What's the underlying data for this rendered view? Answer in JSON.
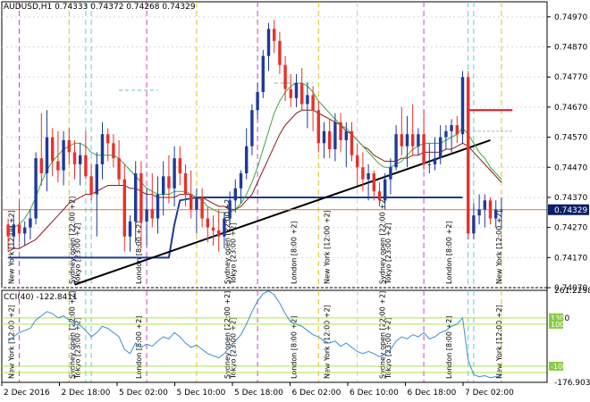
{
  "header": {
    "symbol": "AUDUSD,H1",
    "ohlc": "0.74333 0.74372 0.74268 0.74329"
  },
  "cci_label": "CCI(40) -122.8411",
  "price_tag": "0.74329",
  "colors": {
    "up": "#1e3a9a",
    "down": "#e8312a",
    "ma_fast": "#3aaa3a",
    "ma_slow": "#8b1a1a",
    "channel": "#1e3a9a",
    "trend": "#000000",
    "cci_line": "#3d8fd0",
    "cci_level": "#aee34a",
    "session_magenta": "#cc44cc",
    "session_yellow": "#e0c020",
    "session_cyan": "#66cccc",
    "session_gray": "#c8c8c8"
  },
  "chart_data": [
    {
      "type": "candlestick",
      "title": "AUDUSD,H1",
      "ylim": [
        0.7407,
        0.7502
      ],
      "y_ticks": [
        "0.74970",
        "0.74870",
        "0.74770",
        "0.74670",
        "0.74570",
        "0.74470",
        "0.74370",
        "0.74270",
        "0.74170",
        "0.74070"
      ],
      "x_ticks": [
        "2 Dec 2016",
        "2 Dec 18:00",
        "5 Dec 02:00",
        "5 Dec 10:00",
        "5 Dec 18:00",
        "6 Dec 02:00",
        "6 Dec 10:00",
        "6 Dec 18:00",
        "7 Dec 02:00"
      ],
      "candles": [
        [
          0.7428,
          0.743,
          0.7419,
          0.7424
        ],
        [
          0.7424,
          0.7431,
          0.742,
          0.7428
        ],
        [
          0.7428,
          0.7435,
          0.7422,
          0.7425
        ],
        [
          0.7425,
          0.7429,
          0.7421,
          0.7427
        ],
        [
          0.7427,
          0.7433,
          0.7423,
          0.743
        ],
        [
          0.743,
          0.7452,
          0.7428,
          0.745
        ],
        [
          0.745,
          0.7465,
          0.7441,
          0.7445
        ],
        [
          0.7445,
          0.7466,
          0.7439,
          0.7457
        ],
        [
          0.7457,
          0.746,
          0.7444,
          0.7449
        ],
        [
          0.7449,
          0.7459,
          0.7442,
          0.7446
        ],
        [
          0.7446,
          0.7459,
          0.7441,
          0.7456
        ],
        [
          0.7456,
          0.746,
          0.7448,
          0.7452
        ],
        [
          0.7452,
          0.7456,
          0.7443,
          0.7448
        ],
        [
          0.7448,
          0.7455,
          0.7441,
          0.7451
        ],
        [
          0.7451,
          0.7459,
          0.7443,
          0.7444
        ],
        [
          0.7444,
          0.7448,
          0.7436,
          0.7438
        ],
        [
          0.7438,
          0.7452,
          0.7424,
          0.7448
        ],
        [
          0.7448,
          0.7462,
          0.7443,
          0.7458
        ],
        [
          0.7458,
          0.746,
          0.7449,
          0.7455
        ],
        [
          0.7455,
          0.7458,
          0.7447,
          0.745
        ],
        [
          0.745,
          0.7456,
          0.7441,
          0.7443
        ],
        [
          0.7443,
          0.7448,
          0.7419,
          0.7424
        ],
        [
          0.7424,
          0.7431,
          0.7419,
          0.7429
        ],
        [
          0.7429,
          0.7449,
          0.7422,
          0.7445
        ],
        [
          0.7445,
          0.7449,
          0.742,
          0.7429
        ],
        [
          0.7429,
          0.744,
          0.7421,
          0.7433
        ],
        [
          0.7433,
          0.7445,
          0.7427,
          0.743
        ],
        [
          0.743,
          0.7444,
          0.7425,
          0.7438
        ],
        [
          0.7438,
          0.7449,
          0.7431,
          0.7444
        ],
        [
          0.7444,
          0.7451,
          0.7435,
          0.744
        ],
        [
          0.744,
          0.7454,
          0.7434,
          0.745
        ],
        [
          0.745,
          0.7454,
          0.7441,
          0.7445
        ],
        [
          0.7445,
          0.7448,
          0.7434,
          0.7438
        ],
        [
          0.7438,
          0.7446,
          0.743,
          0.7433
        ],
        [
          0.7433,
          0.744,
          0.7425,
          0.7437
        ],
        [
          0.7437,
          0.744,
          0.7427,
          0.743
        ],
        [
          0.743,
          0.7434,
          0.7422,
          0.7427
        ],
        [
          0.7427,
          0.7431,
          0.7421,
          0.7426
        ],
        [
          0.7426,
          0.7433,
          0.7419,
          0.7424
        ],
        [
          0.7424,
          0.7432,
          0.742,
          0.743
        ],
        [
          0.743,
          0.7439,
          0.7428,
          0.7436
        ],
        [
          0.7436,
          0.7443,
          0.7432,
          0.744
        ],
        [
          0.744,
          0.7446,
          0.7435,
          0.7445
        ],
        [
          0.7445,
          0.746,
          0.7443,
          0.7454
        ],
        [
          0.7454,
          0.7468,
          0.7451,
          0.7466
        ],
        [
          0.7466,
          0.7475,
          0.7463,
          0.7472
        ],
        [
          0.7472,
          0.7486,
          0.747,
          0.7484
        ],
        [
          0.7484,
          0.7495,
          0.7479,
          0.7493
        ],
        [
          0.7493,
          0.7496,
          0.7485,
          0.7489
        ],
        [
          0.7489,
          0.7492,
          0.7478,
          0.7481
        ],
        [
          0.7481,
          0.7484,
          0.7469,
          0.7473
        ],
        [
          0.7473,
          0.7478,
          0.7467,
          0.747
        ],
        [
          0.747,
          0.7478,
          0.7467,
          0.7475
        ],
        [
          0.7475,
          0.748,
          0.7466,
          0.7468
        ],
        [
          0.7468,
          0.7475,
          0.746,
          0.7471
        ],
        [
          0.7471,
          0.7474,
          0.7459,
          0.7466
        ],
        [
          0.7466,
          0.7469,
          0.7452,
          0.7455
        ],
        [
          0.7455,
          0.7462,
          0.745,
          0.7459
        ],
        [
          0.7459,
          0.7463,
          0.745,
          0.7453
        ],
        [
          0.7453,
          0.7465,
          0.7449,
          0.7462
        ],
        [
          0.7462,
          0.7465,
          0.7452,
          0.7456
        ],
        [
          0.7456,
          0.7462,
          0.7447,
          0.7459
        ],
        [
          0.7459,
          0.7462,
          0.7449,
          0.7451
        ],
        [
          0.7451,
          0.7455,
          0.7441,
          0.7447
        ],
        [
          0.7447,
          0.7452,
          0.7439,
          0.7443
        ],
        [
          0.7443,
          0.7448,
          0.7436,
          0.7445
        ],
        [
          0.7445,
          0.7446,
          0.7436,
          0.7439
        ],
        [
          0.7439,
          0.7442,
          0.7434,
          0.7436
        ],
        [
          0.7436,
          0.7445,
          0.7433,
          0.7443
        ],
        [
          0.7443,
          0.745,
          0.7438,
          0.7447
        ],
        [
          0.7447,
          0.7461,
          0.7446,
          0.7458
        ],
        [
          0.7458,
          0.7467,
          0.7451,
          0.7454
        ],
        [
          0.7454,
          0.7464,
          0.7447,
          0.7458
        ],
        [
          0.7458,
          0.7468,
          0.7451,
          0.7454
        ],
        [
          0.7454,
          0.746,
          0.7451,
          0.7458
        ],
        [
          0.7458,
          0.7466,
          0.7446,
          0.7448
        ],
        [
          0.7448,
          0.7455,
          0.7445,
          0.7448
        ],
        [
          0.7448,
          0.7457,
          0.7446,
          0.745
        ],
        [
          0.745,
          0.7461,
          0.7448,
          0.7457
        ],
        [
          0.7457,
          0.7461,
          0.7453,
          0.7459
        ],
        [
          0.7459,
          0.7463,
          0.7452,
          0.7461
        ],
        [
          0.7461,
          0.7464,
          0.7455,
          0.7458
        ],
        [
          0.7458,
          0.7479,
          0.7455,
          0.7477
        ],
        [
          0.7477,
          0.7479,
          0.7423,
          0.7425
        ],
        [
          0.7425,
          0.7435,
          0.7423,
          0.7431
        ],
        [
          0.7431,
          0.7438,
          0.7428,
          0.7433
        ],
        [
          0.7433,
          0.7438,
          0.7427,
          0.7436
        ],
        [
          0.7436,
          0.7437,
          0.7428,
          0.743
        ],
        [
          0.743,
          0.7436,
          0.7427,
          0.7433
        ],
        [
          0.7433,
          0.7437,
          0.7427,
          0.7433
        ]
      ],
      "ma_fast": [
        0.7427,
        0.7427,
        0.7428,
        0.743,
        0.7433,
        0.7437,
        0.7442,
        0.7446,
        0.7449,
        0.7451,
        0.7453,
        0.7454,
        0.7455,
        0.7455,
        0.7454,
        0.7452,
        0.7451,
        0.7451,
        0.7451,
        0.7451,
        0.745,
        0.7448,
        0.7446,
        0.7444,
        0.7442,
        0.744,
        0.7439,
        0.7438,
        0.7438,
        0.7438,
        0.7439,
        0.7439,
        0.7439,
        0.7438,
        0.7437,
        0.7436,
        0.7434,
        0.7433,
        0.7432,
        0.7432,
        0.7432,
        0.7433,
        0.7435,
        0.7438,
        0.7442,
        0.7447,
        0.7453,
        0.7459,
        0.7465,
        0.7469,
        0.7472,
        0.7474,
        0.7475,
        0.7475,
        0.7474,
        0.7472,
        0.7469,
        0.7467,
        0.7465,
        0.7463,
        0.7461,
        0.746,
        0.7458,
        0.7456,
        0.7454,
        0.7452,
        0.745,
        0.7448,
        0.7447,
        0.7447,
        0.7448,
        0.7449,
        0.7451,
        0.7453,
        0.7454,
        0.7455,
        0.7455,
        0.7455,
        0.7455,
        0.7456,
        0.7457,
        0.7458,
        0.746,
        0.7458,
        0.7455,
        0.7452,
        0.745,
        0.7447,
        0.7445,
        0.7443
      ],
      "ma_slow": [
        0.7419,
        0.742,
        0.742,
        0.7421,
        0.7422,
        0.7423,
        0.7425,
        0.7427,
        0.7429,
        0.7431,
        0.7433,
        0.7435,
        0.7436,
        0.7437,
        0.7438,
        0.7438,
        0.7439,
        0.744,
        0.7441,
        0.7441,
        0.7441,
        0.7441,
        0.744,
        0.744,
        0.7439,
        0.7438,
        0.7438,
        0.7437,
        0.7437,
        0.7437,
        0.7437,
        0.7438,
        0.7438,
        0.7438,
        0.7437,
        0.7437,
        0.7436,
        0.7435,
        0.7434,
        0.7434,
        0.7433,
        0.7433,
        0.7434,
        0.7436,
        0.7438,
        0.7442,
        0.7446,
        0.745,
        0.7454,
        0.7458,
        0.7461,
        0.7463,
        0.7465,
        0.7466,
        0.7466,
        0.7466,
        0.7465,
        0.7464,
        0.7463,
        0.7462,
        0.7461,
        0.7459,
        0.7458,
        0.7456,
        0.7454,
        0.7453,
        0.7451,
        0.745,
        0.7449,
        0.7449,
        0.7449,
        0.745,
        0.745,
        0.7451,
        0.7451,
        0.7452,
        0.7452,
        0.7452,
        0.7452,
        0.7453,
        0.7453,
        0.7454,
        0.7455,
        0.7454,
        0.7452,
        0.745,
        0.7448,
        0.7446,
        0.7444,
        0.7442
      ]
    },
    {
      "type": "line",
      "title": "CCI(40) -122.8411",
      "ylim": [
        -176.9038,
        261.2298
      ],
      "y_ticks": [
        "261.2298",
        "130",
        "100",
        "-100",
        "-176.9038"
      ],
      "levels": [
        130,
        100,
        -100,
        -130
      ],
      "values": [
        20,
        40,
        60,
        70,
        80,
        120,
        140,
        160,
        150,
        130,
        140,
        120,
        100,
        95,
        70,
        40,
        60,
        90,
        80,
        60,
        40,
        -20,
        -40,
        10,
        -10,
        5,
        -5,
        20,
        40,
        30,
        60,
        40,
        10,
        -10,
        0,
        -20,
        -40,
        -50,
        -60,
        -40,
        -10,
        20,
        50,
        100,
        160,
        210,
        245,
        258,
        240,
        200,
        150,
        110,
        100,
        90,
        70,
        50,
        40,
        20,
        10,
        20,
        -5,
        10,
        -10,
        -30,
        -40,
        -30,
        -40,
        -55,
        -40,
        -20,
        20,
        40,
        30,
        50,
        40,
        60,
        30,
        40,
        60,
        70,
        90,
        100,
        130,
        -70,
        -140,
        -150,
        -145,
        -155,
        -150,
        -152
      ]
    }
  ],
  "indicator_price_lines": {
    "red_resistance": 0.7466,
    "gray_level": 0.7459
  },
  "session_labels": [
    "New York [12:00 +2]",
    "Sydney open [22:00 +2]",
    "Tokyo [23:00 +2]",
    "London [8:00 +2]",
    "Sydney open [22:00 +2]",
    "Tokyo [23:00 +2]",
    "London [8:00 +2]",
    "New York [12:00 +2]",
    "Sydney open [22:00 +2]",
    "Tokyo [23:00 +2]",
    "London [8:00 +2]",
    "New York [12:00 +2]"
  ]
}
